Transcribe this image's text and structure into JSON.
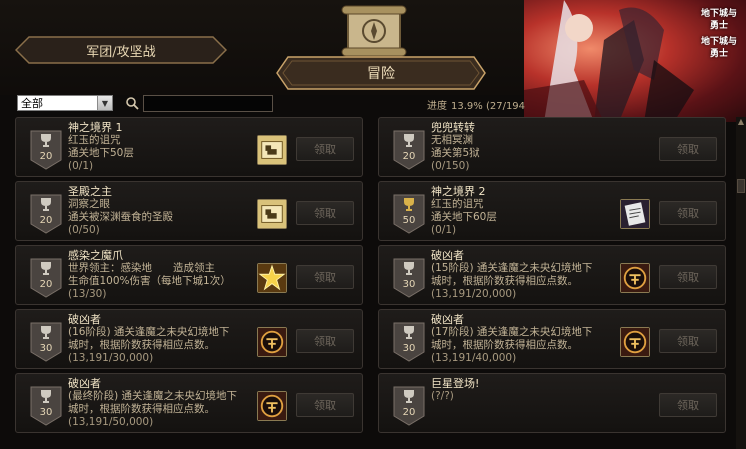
{
  "tabs": {
    "legion": "军团/攻坚战",
    "adventure": "冒险"
  },
  "filter": {
    "selected": "全部"
  },
  "search": {
    "placeholder": ""
  },
  "progress": {
    "label": "进度",
    "value": "13.9% (27/194"
  },
  "promo": {
    "logo_line1": "地下城与",
    "logo_line2": "勇士"
  },
  "claim_label": "领取",
  "achievements": [
    {
      "title": "神之境界 1",
      "sub1": "红玉的诅咒",
      "sub2": "通关地下50层",
      "count": "(0/1)",
      "points": "20",
      "trophy": "silver",
      "reward_icon": "map-scroll-icon"
    },
    {
      "title": "兜兜转转",
      "sub1": "无相冥渊",
      "sub2": "通关第5狱",
      "count": "(0/150)",
      "points": "20",
      "trophy": "silver",
      "reward_icon": ""
    },
    {
      "title": "圣殿之主",
      "sub1": "洞察之眼",
      "sub2": "通关被深渊蚕食的圣殿",
      "count": "(0/50)",
      "points": "20",
      "trophy": "silver",
      "reward_icon": "map-scroll-icon"
    },
    {
      "title": "神之境界 2",
      "sub1": "红玉的诅咒",
      "sub2": "通关地下60层",
      "count": "(0/1)",
      "points": "50",
      "trophy": "gold",
      "reward_icon": "contract-icon"
    },
    {
      "title": "感染之魔爪",
      "sub1": "世界领主：感染地　　造成领主",
      "sub2": "生命值100%伤害（每地下城1次）",
      "count": "(13/30)",
      "points": "20",
      "trophy": "silver",
      "reward_icon": "gold-burst-icon"
    },
    {
      "title": "破凶者",
      "sub1": "(15阶段) 通关逢魔之未央幻境地下",
      "sub2": "城时，根据阶数获得相应点数。",
      "count": "(13,191/20,000)",
      "points": "30",
      "trophy": "silver",
      "reward_icon": "rune-emblem-icon"
    },
    {
      "title": "破凶者",
      "sub1": "(16阶段) 通关逢魔之未央幻境地下",
      "sub2": "城时，根据阶数获得相应点数。",
      "count": "(13,191/30,000)",
      "points": "30",
      "trophy": "silver",
      "reward_icon": "rune-emblem-icon"
    },
    {
      "title": "破凶者",
      "sub1": "(17阶段) 通关逢魔之未央幻境地下",
      "sub2": "城时，根据阶数获得相应点数。",
      "count": "(13,191/40,000)",
      "points": "30",
      "trophy": "silver",
      "reward_icon": "rune-emblem-icon"
    },
    {
      "title": "破凶者",
      "sub1": "(最终阶段) 通关逢魔之未央幻境地下",
      "sub2": "城时，根据阶数获得相应点数。",
      "count": "(13,191/50,000)",
      "points": "30",
      "trophy": "silver",
      "reward_icon": "rune-emblem-icon"
    },
    {
      "title": "巨星登场!",
      "sub1": "",
      "sub2": "",
      "count": "(?/?)",
      "points": "20",
      "trophy": "silver",
      "reward_icon": ""
    }
  ]
}
